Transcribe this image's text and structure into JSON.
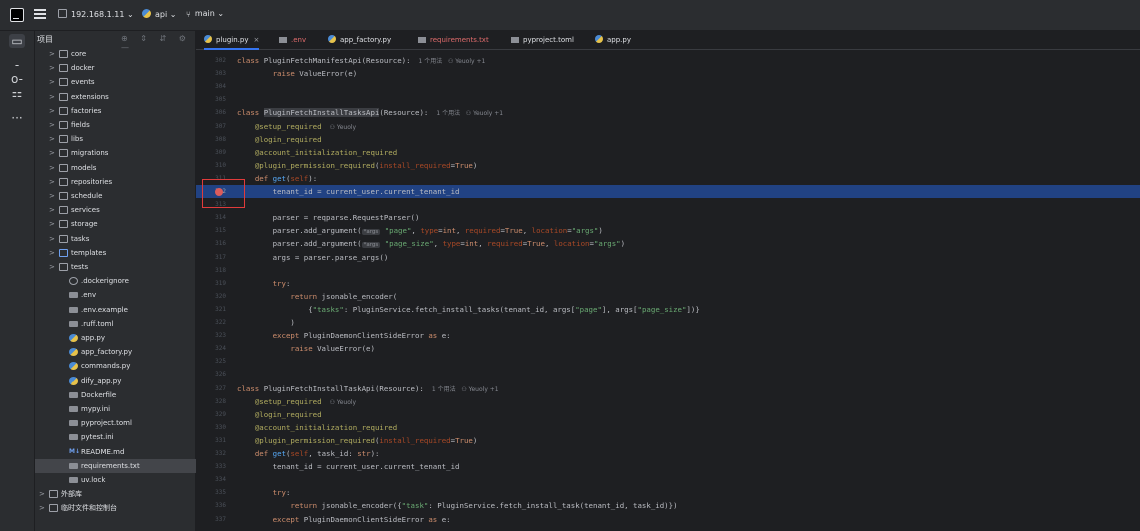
{
  "titlebar": {
    "ip": "192.168.1.11",
    "project": "api",
    "branch": "main",
    "chevron": "⌄"
  },
  "activity": {
    "icons": [
      "folder-icon",
      "commit-icon",
      "structure-icon",
      "more-icon"
    ]
  },
  "project_panel": {
    "title": "项目",
    "rows": [
      {
        "label": "core",
        "type": "folder",
        "indent": 1,
        "arrow": ">"
      },
      {
        "label": "docker",
        "type": "folder",
        "indent": 1,
        "arrow": ">"
      },
      {
        "label": "events",
        "type": "folder",
        "indent": 1,
        "arrow": ">"
      },
      {
        "label": "extensions",
        "type": "folder",
        "indent": 1,
        "arrow": ">"
      },
      {
        "label": "factories",
        "type": "folder",
        "indent": 1,
        "arrow": ">"
      },
      {
        "label": "fields",
        "type": "folder",
        "indent": 1,
        "arrow": ">"
      },
      {
        "label": "libs",
        "type": "folder",
        "indent": 1,
        "arrow": ">"
      },
      {
        "label": "migrations",
        "type": "folder",
        "indent": 1,
        "arrow": ">"
      },
      {
        "label": "models",
        "type": "folder",
        "indent": 1,
        "arrow": ">"
      },
      {
        "label": "repositories",
        "type": "folder",
        "indent": 1,
        "arrow": ">"
      },
      {
        "label": "schedule",
        "type": "folder",
        "indent": 1,
        "arrow": ">"
      },
      {
        "label": "services",
        "type": "folder",
        "indent": 1,
        "arrow": ">"
      },
      {
        "label": "storage",
        "type": "folder",
        "indent": 1,
        "arrow": ">"
      },
      {
        "label": "tasks",
        "type": "folder",
        "indent": 1,
        "arrow": ">"
      },
      {
        "label": "templates",
        "type": "folder-blue",
        "indent": 1,
        "arrow": ">"
      },
      {
        "label": "tests",
        "type": "folder",
        "indent": 1,
        "arrow": ">"
      },
      {
        "label": ".dockerignore",
        "type": "ignore",
        "indent": 2,
        "arrow": ""
      },
      {
        "label": ".env",
        "type": "file",
        "indent": 2,
        "arrow": ""
      },
      {
        "label": ".env.example",
        "type": "file",
        "indent": 2,
        "arrow": ""
      },
      {
        "label": ".ruff.toml",
        "type": "file",
        "indent": 2,
        "arrow": ""
      },
      {
        "label": "app.py",
        "type": "py",
        "indent": 2,
        "arrow": ""
      },
      {
        "label": "app_factory.py",
        "type": "py",
        "indent": 2,
        "arrow": ""
      },
      {
        "label": "commands.py",
        "type": "py",
        "indent": 2,
        "arrow": ""
      },
      {
        "label": "dify_app.py",
        "type": "py",
        "indent": 2,
        "arrow": ""
      },
      {
        "label": "Dockerfile",
        "type": "file",
        "indent": 2,
        "arrow": ""
      },
      {
        "label": "mypy.ini",
        "type": "file",
        "indent": 2,
        "arrow": ""
      },
      {
        "label": "pyproject.toml",
        "type": "file",
        "indent": 2,
        "arrow": ""
      },
      {
        "label": "pytest.ini",
        "type": "file",
        "indent": 2,
        "arrow": ""
      },
      {
        "label": "README.md",
        "type": "md",
        "indent": 2,
        "arrow": ""
      },
      {
        "label": "requirements.txt",
        "type": "file",
        "indent": 2,
        "arrow": "",
        "selected": true
      },
      {
        "label": "uv.lock",
        "type": "file",
        "indent": 2,
        "arrow": ""
      },
      {
        "label": "外部库",
        "type": "lib",
        "indent": 0,
        "arrow": ">"
      },
      {
        "label": "临时文件和控制台",
        "type": "scratch",
        "indent": 0,
        "arrow": ">"
      }
    ]
  },
  "tabs": [
    {
      "label": "plugin.py",
      "active": true,
      "close": "×"
    },
    {
      "label": ".env",
      "active": false
    },
    {
      "label": "app_factory.py",
      "active": false
    },
    {
      "label": "requirements.txt",
      "active": false
    },
    {
      "label": "pyproject.toml",
      "active": false
    },
    {
      "label": "app.py",
      "active": false
    }
  ],
  "editor": {
    "usage_hint_1": "1 个用法",
    "author_hint": "Yeuoly +1",
    "author_hint_single": "Yeuoly",
    "lines": [
      {
        "n": "302",
        "html": "<span class='k'>class</span> <span class='cls'>PluginFetchManifestApi(Resource):</span>",
        "hint": true
      },
      {
        "n": "303",
        "html": "        <span class='k'>raise</span> ValueError(e)"
      },
      {
        "n": "304",
        "html": ""
      },
      {
        "n": "305",
        "html": ""
      },
      {
        "n": "306",
        "html": "<span class='k'>class</span> <span class='cls' style='background:#3b3d42'>PluginFetchInstallTasksApi</span>(Resource):",
        "hint": true
      },
      {
        "n": "307",
        "html": "    <span class='d'>@setup_required</span>",
        "author": true
      },
      {
        "n": "308",
        "html": "    <span class='d'>@login_required</span>"
      },
      {
        "n": "309",
        "html": "    <span class='d'>@account_initialization_required</span>"
      },
      {
        "n": "310",
        "html": "    <span class='d'>@plugin_permission_required</span>(<span class='p'>install_required</span>=<span class='k'>True</span>)"
      },
      {
        "n": "311",
        "html": "    <span class='k'>def</span> <span class='c'>get</span>(<span class='p'>self</span>):"
      },
      {
        "n": "312",
        "html": "        tenant_id = current_user.current_tenant_id",
        "hl": true
      },
      {
        "n": "313",
        "html": ""
      },
      {
        "n": "314",
        "html": "        parser = reqparse.RequestParser()"
      },
      {
        "n": "315",
        "html": "        parser.add_argument(<span class='inlay'>*args</span> <span class='s'>\"page\"</span>, <span class='p'>type</span>=<span class='k'>int</span>, <span class='p'>required</span>=<span class='k'>True</span>, <span class='p'>location</span>=<span class='s'>\"args\"</span>)"
      },
      {
        "n": "316",
        "html": "        parser.add_argument(<span class='inlay'>*args</span> <span class='s'>\"page_size\"</span>, <span class='p'>type</span>=<span class='k'>int</span>, <span class='p'>required</span>=<span class='k'>True</span>, <span class='p'>location</span>=<span class='s'>\"args\"</span>)"
      },
      {
        "n": "317",
        "html": "        args = parser.parse_args()"
      },
      {
        "n": "318",
        "html": ""
      },
      {
        "n": "319",
        "html": "        <span class='k'>try</span>:"
      },
      {
        "n": "320",
        "html": "            <span class='k'>return</span> jsonable_encoder("
      },
      {
        "n": "321",
        "html": "                {<span class='s'>\"tasks\"</span>: PluginService.fetch_install_tasks(tenant_id, args[<span class='s'>\"page\"</span>], args[<span class='s'>\"page_size\"</span>])}"
      },
      {
        "n": "322",
        "html": "            )"
      },
      {
        "n": "323",
        "html": "        <span class='k'>except</span> PluginDaemonClientSideError <span class='k'>as</span> e:"
      },
      {
        "n": "324",
        "html": "            <span class='k'>raise</span> ValueError(e)"
      },
      {
        "n": "325",
        "html": ""
      },
      {
        "n": "326",
        "html": ""
      },
      {
        "n": "327",
        "html": "<span class='k'>class</span> <span class='cls'>PluginFetchInstallTaskApi(Resource):</span>",
        "hint": true
      },
      {
        "n": "328",
        "html": "    <span class='d'>@setup_required</span>",
        "author": true
      },
      {
        "n": "329",
        "html": "    <span class='d'>@login_required</span>"
      },
      {
        "n": "330",
        "html": "    <span class='d'>@account_initialization_required</span>"
      },
      {
        "n": "331",
        "html": "    <span class='d'>@plugin_permission_required</span>(<span class='p'>install_required</span>=<span class='k'>True</span>)"
      },
      {
        "n": "332",
        "html": "    <span class='k'>def</span> <span class='c'>get</span>(<span class='p'>self</span>, task_id: <span class='k'>str</span>):"
      },
      {
        "n": "333",
        "html": "        tenant_id = current_user.current_tenant_id"
      },
      {
        "n": "334",
        "html": ""
      },
      {
        "n": "335",
        "html": "        <span class='k'>try</span>:"
      },
      {
        "n": "336",
        "html": "            <span class='k'>return</span> jsonable_encoder({<span class='s'>\"task\"</span>: PluginService.fetch_install_task(tenant_id, task_id)})"
      },
      {
        "n": "337",
        "html": "        <span class='k'>except</span> PluginDaemonClientSideError <span class='k'>as</span> e:"
      }
    ]
  }
}
